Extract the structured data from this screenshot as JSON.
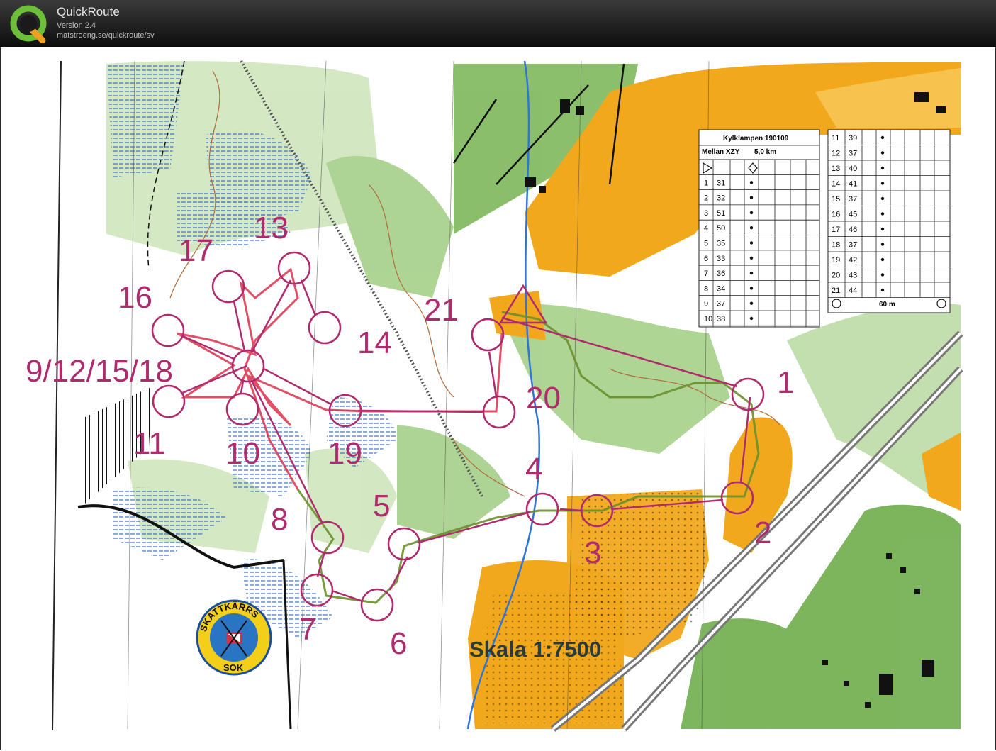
{
  "app": {
    "title": "QuickRoute",
    "version": "Version 2.4",
    "url": "matstroeng.se/quickroute/sv",
    "logo_letter": "Q"
  },
  "map": {
    "scale_label": "Skala 1:7500",
    "club_logo": {
      "top_text": "SKATTKÄRRS",
      "bottom_text": "SOK"
    },
    "colors": {
      "course": "#b02a6e",
      "route": "#d9304a",
      "open_land": "#f2a81c",
      "forest": "#9cc97a",
      "marsh": "#3a6fc4"
    },
    "control_labels": [
      "1",
      "2",
      "3",
      "4",
      "5",
      "6",
      "7",
      "8",
      "9/12/15/18",
      "10",
      "11",
      "13",
      "14",
      "16",
      "17",
      "19",
      "20",
      "21"
    ]
  },
  "description_sheet": {
    "event": "Kylklampen 190109",
    "course": "Mellan XZY",
    "length": "5,0 km",
    "left_rows": [
      {
        "n": "1",
        "code": "31"
      },
      {
        "n": "2",
        "code": "32"
      },
      {
        "n": "3",
        "code": "51"
      },
      {
        "n": "4",
        "code": "50"
      },
      {
        "n": "5",
        "code": "35"
      },
      {
        "n": "6",
        "code": "33"
      },
      {
        "n": "7",
        "code": "36"
      },
      {
        "n": "8",
        "code": "34"
      },
      {
        "n": "9",
        "code": "37"
      },
      {
        "n": "10",
        "code": "38"
      }
    ],
    "right_rows": [
      {
        "n": "11",
        "code": "39"
      },
      {
        "n": "12",
        "code": "37"
      },
      {
        "n": "13",
        "code": "40"
      },
      {
        "n": "14",
        "code": "41"
      },
      {
        "n": "15",
        "code": "37"
      },
      {
        "n": "16",
        "code": "45"
      },
      {
        "n": "17",
        "code": "46"
      },
      {
        "n": "18",
        "code": "37"
      },
      {
        "n": "19",
        "code": "42"
      },
      {
        "n": "20",
        "code": "43"
      },
      {
        "n": "21",
        "code": "44"
      }
    ],
    "finish_distance": "60 m"
  }
}
